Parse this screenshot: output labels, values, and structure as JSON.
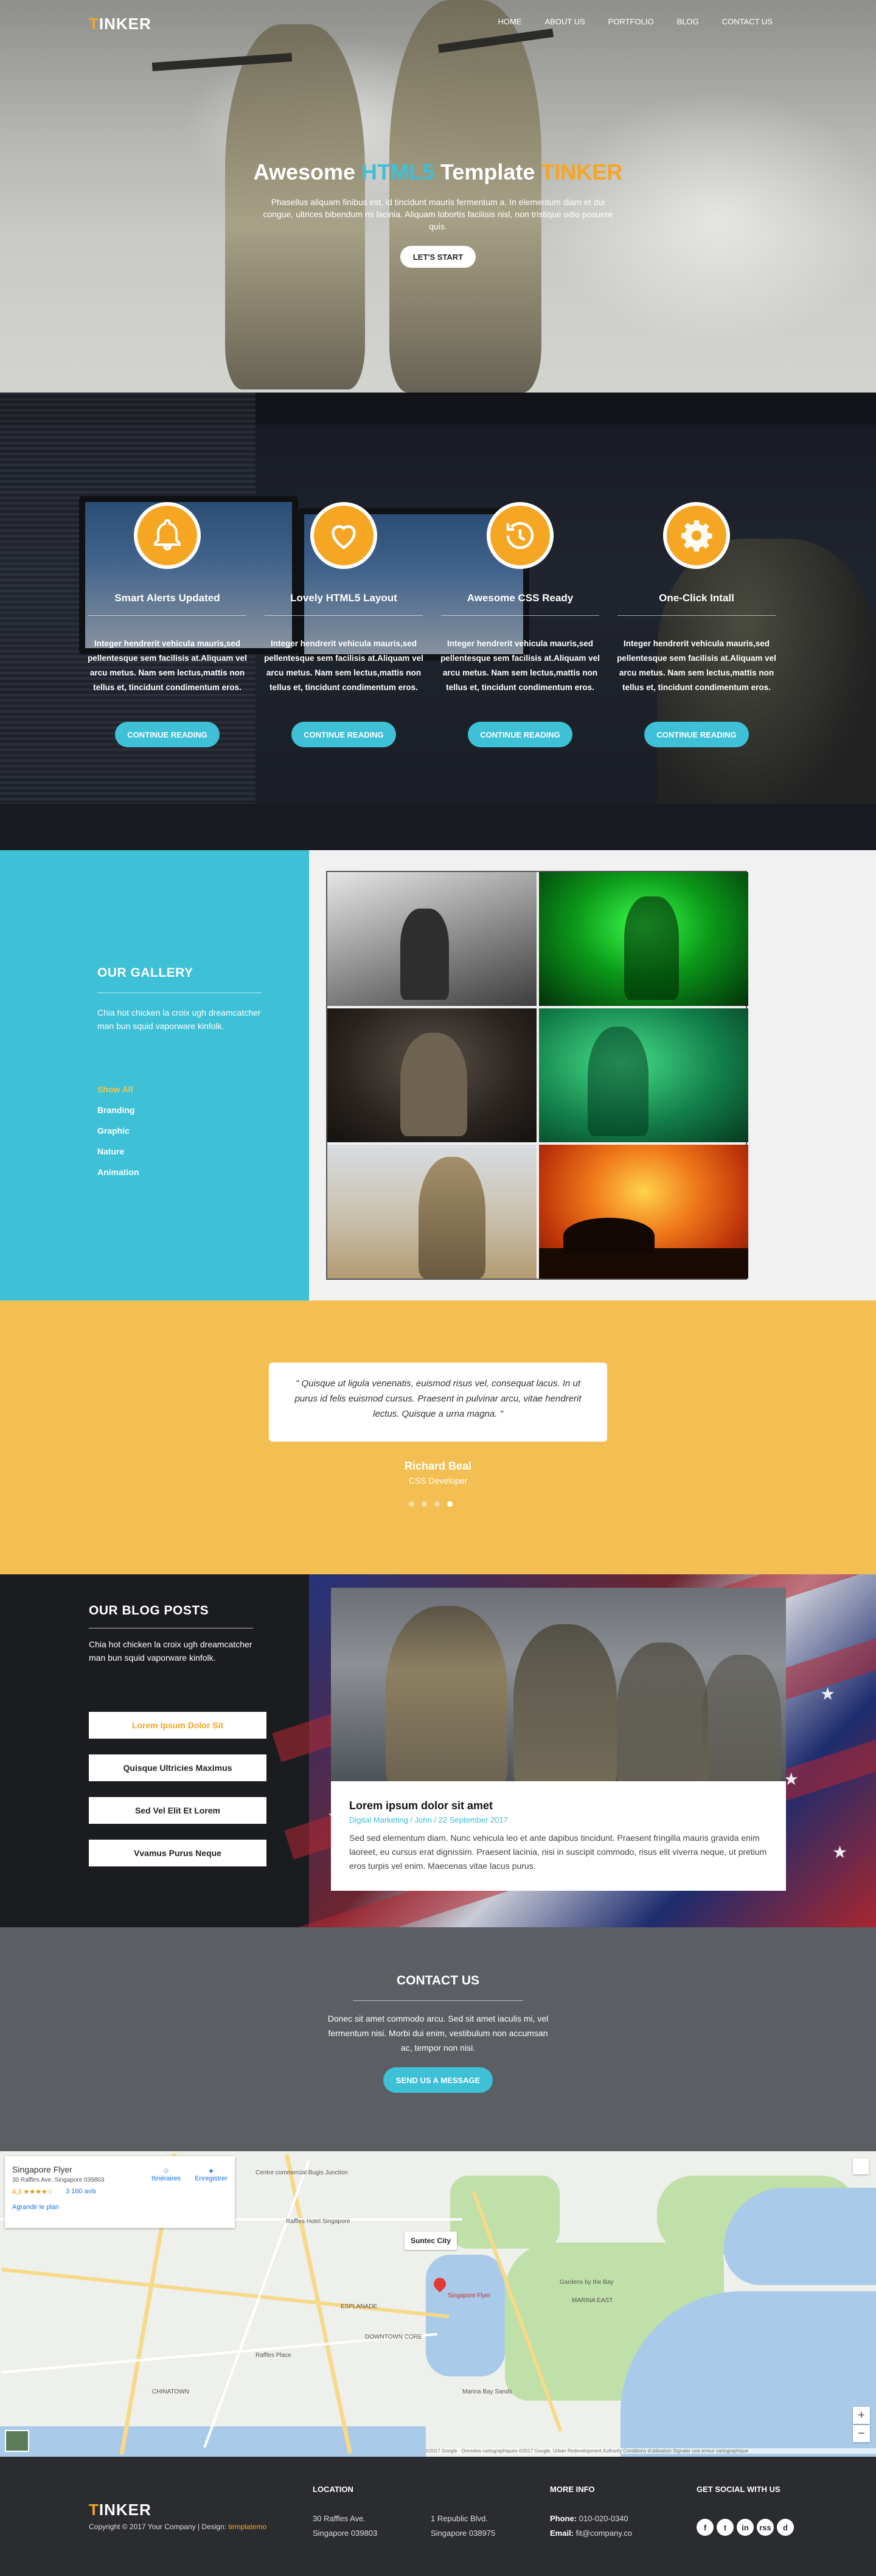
{
  "brand": {
    "logo_initial": "T",
    "logo_rest": "INKER"
  },
  "nav": {
    "items": [
      "HOME",
      "ABOUT US",
      "PORTFOLIO",
      "BLOG",
      "CONTACT US"
    ]
  },
  "hero": {
    "title_part1": "Awesome ",
    "title_part2": "HTML5",
    "title_part3": " Template ",
    "title_part4": "TINKER",
    "subtitle": "Phasellus aliquam finibus est, id tincidunt mauris fermentum a. In elementum diam et dui congue, ultrices bibendum mi lacinia. Aliquam lobortis facilisis nisl, non tristique odio posuere quis.",
    "button": "LET'S START"
  },
  "features": {
    "items": [
      {
        "icon": "bell-icon",
        "title": "Smart Alerts Updated",
        "text": "Integer hendrerit vehicula mauris,sed pellentesque sem facilisis at.Aliquam vel arcu metus. Nam sem lectus,mattis non tellus et, tincidunt condimentum eros.",
        "button": "CONTINUE READING"
      },
      {
        "icon": "heart-icon",
        "title": "Lovely HTML5 Layout",
        "text": "Integer hendrerit vehicula mauris,sed pellentesque sem facilisis at.Aliquam vel arcu metus. Nam sem lectus,mattis non tellus et, tincidunt condimentum eros.",
        "button": "CONTINUE READING"
      },
      {
        "icon": "history-icon",
        "title": "Awesome CSS Ready",
        "text": "Integer hendrerit vehicula mauris,sed pellentesque sem facilisis at.Aliquam vel arcu metus. Nam sem lectus,mattis non tellus et, tincidunt condimentum eros.",
        "button": "CONTINUE READING"
      },
      {
        "icon": "gear-icon",
        "title": "One-Click Intall",
        "text": "Integer hendrerit vehicula mauris,sed pellentesque sem facilisis at.Aliquam vel arcu metus. Nam sem lectus,mattis non tellus et, tincidunt condimentum eros.",
        "button": "CONTINUE READING"
      }
    ]
  },
  "gallery": {
    "title": "OUR GALLERY",
    "text": "Chia hot chicken la croix ugh dreamcatcher man bun squid vaporware kinfolk.",
    "filters": [
      "Show All",
      "Branding",
      "Graphic",
      "Nature",
      "Animation"
    ]
  },
  "testimonial": {
    "quote": "\" Quisque ut ligula venenatis, euismod risus vel, consequat lacus. In ut purus id felis euismod cursus. Praesent in pulvinar arcu, vitae hendrerit lectus. Quisque a urna magna. \"",
    "name": "Richard Beal",
    "role": "CSS Developer"
  },
  "blog": {
    "title": "OUR BLOG POSTS",
    "text": "Chia hot chicken la croix ugh dreamcatcher man bun squid vaporware kinfolk.",
    "buttons": [
      "Lorem Ipsum Dolor Sit",
      "Quisque Ultricies Maximus",
      "Sed Vel Elit Et Lorem",
      "Vvamus Purus Neque"
    ],
    "post": {
      "title": "Lorem ipsum dolor sit amet",
      "meta": "Digital Marketing / John / 22 September 2017",
      "text": "Sed sed elementum diam. Nunc vehicula leo et ante dapibus tincidunt. Praesent fringilla mauris gravida enim laoreet, eu cursus erat dignissim. Praesent lacinia, nisi in suscipit commodo, risus elit viverra neque, ut pretium eros turpis vel enim. Maecenas vitae lacus purus."
    }
  },
  "contact": {
    "title": "CONTACT US",
    "text": "Donec sit amet commodo arcu. Sed sit amet iaculis mi, vel fermentum nisi. Morbi dui enim, vestibulum non accumsan ac, tempor non nisi.",
    "button": "SEND US A MESSAGE"
  },
  "map": {
    "place_name": "Singapore Flyer",
    "place_address": "30 Raffles Ave, Singapore 039803",
    "rating": "4,3 ★★★★☆",
    "reviews": "3 160 avis",
    "larger_map": "Agrandir le plan",
    "directions": "Itinéraires",
    "save": "Enregistrer",
    "callout": "Suntec City",
    "labels": [
      "Centre commercial Bugis Junction",
      "Raffles Hotel Singapore",
      "Marina Bay Sands",
      "Gardens by the Bay",
      "MARINA EAST",
      "Singapore Flyer",
      "ESPLANADE",
      "Raffles Place",
      "CHINATOWN",
      "DOWNTOWN CORE",
      "Suntec City"
    ],
    "attribution": "©2017 Google - Données cartographiques ©2017 Google, Urban Redevelopment Authority   Conditions d'utilisation   Signaler une erreur cartographique"
  },
  "footer": {
    "logo_initial": "T",
    "logo_rest": "INKER",
    "copyright_prefix": "Copyright © 2017 Your Company | Design: ",
    "copyright_link": "templatemo",
    "location_title": "LOCATION",
    "loc1_line1": "30 Raffles Ave.",
    "loc1_line2": "Singapore 039803",
    "loc2_line1": "1 Republic Blvd.",
    "loc2_line2": "Singapore 038975",
    "more_title": "MORE INFO",
    "phone_label": "Phone:",
    "phone": "010-020-0340",
    "email_label": "Email:",
    "email": "fit@company.co",
    "social_title": "GET SOCIAL WITH US",
    "social": [
      "f",
      "t",
      "in",
      "rss",
      "d"
    ]
  }
}
